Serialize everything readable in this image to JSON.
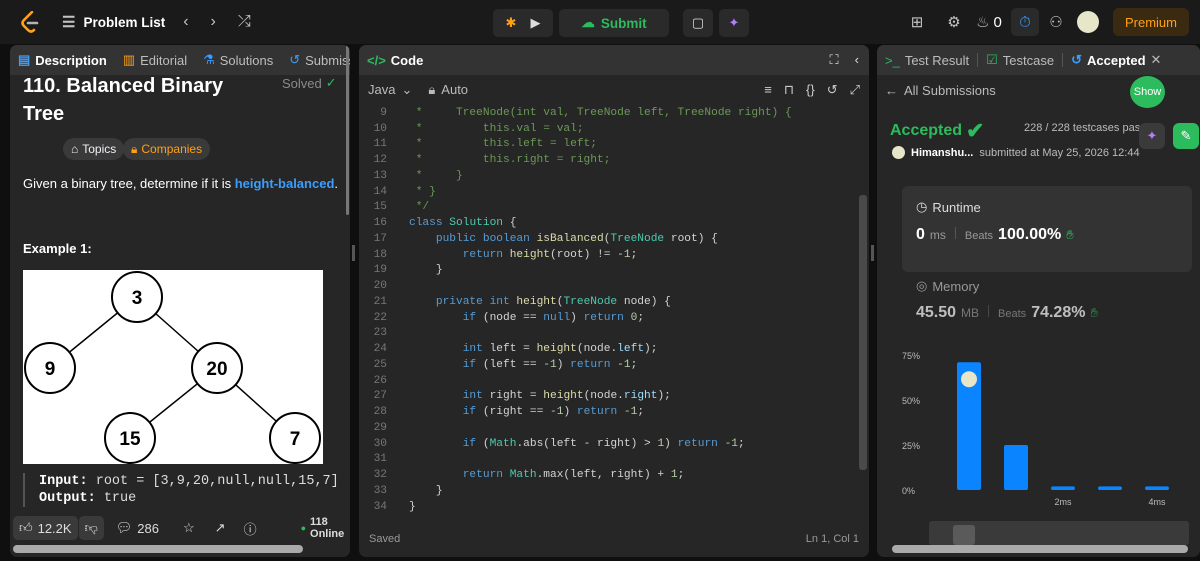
{
  "topbar": {
    "problem_list_label": "Problem List",
    "streak_count": "0",
    "premium_label": "Premium",
    "submit_label": "Submit"
  },
  "left_panel": {
    "tabs": [
      {
        "label": "Description",
        "icon": "document-icon"
      },
      {
        "label": "Editorial",
        "icon": "book-icon"
      },
      {
        "label": "Solutions",
        "icon": "flask-icon"
      },
      {
        "label": "Submiss",
        "icon": "history-icon"
      }
    ],
    "title": "110. Balanced Binary Tree",
    "solved_label": "Solved",
    "topics_label": "Topics",
    "companies_label": "Companies",
    "description_prefix": "Given a binary tree, determine if it is ",
    "description_highlight": "height-balanced",
    "description_suffix": ".",
    "example_title": "Example 1:",
    "tree_nodes": [
      "3",
      "9",
      "20",
      "15",
      "7"
    ],
    "input_label": "Input:",
    "input_value": "root = [3,9,20,null,null,15,7]",
    "output_label": "Output:",
    "output_value": "true",
    "likes": "12.2K",
    "comments": "286",
    "online": "118 Online"
  },
  "code_panel": {
    "title": "Code",
    "language": "Java",
    "mode": "Auto",
    "status": "Saved",
    "cursor": "Ln 1, Col 1"
  },
  "code_lines": [
    [
      {
        "t": " *     TreeNode(int val, TreeNode left, TreeNode right) {",
        "c": "cm"
      }
    ],
    [
      {
        "t": " *         this.val = val;",
        "c": "cm"
      }
    ],
    [
      {
        "t": " *         this.left = left;",
        "c": "cm"
      }
    ],
    [
      {
        "t": " *         this.right = right;",
        "c": "cm"
      }
    ],
    [
      {
        "t": " *     }",
        "c": "cm"
      }
    ],
    [
      {
        "t": " * }",
        "c": "cm"
      }
    ],
    [
      {
        "t": " */",
        "c": "cm"
      }
    ],
    [
      {
        "t": "class ",
        "c": "kw"
      },
      {
        "t": "Solution",
        "c": "ty"
      },
      {
        "t": " {",
        "c": "tx"
      }
    ],
    [
      {
        "t": "    public boolean ",
        "c": "kw"
      },
      {
        "t": "isBalanced",
        "c": "fn"
      },
      {
        "t": "(",
        "c": "tx"
      },
      {
        "t": "TreeNode",
        "c": "ty"
      },
      {
        "t": " root) {",
        "c": "tx"
      }
    ],
    [
      {
        "t": "        return ",
        "c": "kw"
      },
      {
        "t": "height",
        "c": "fn"
      },
      {
        "t": "(root) != ",
        "c": "tx"
      },
      {
        "t": "-1",
        "c": "nm"
      },
      {
        "t": ";",
        "c": "tx"
      }
    ],
    [
      {
        "t": "    }",
        "c": "tx"
      }
    ],
    [
      {
        "t": "",
        "c": "tx"
      }
    ],
    [
      {
        "t": "    private int ",
        "c": "kw"
      },
      {
        "t": "height",
        "c": "fn"
      },
      {
        "t": "(",
        "c": "tx"
      },
      {
        "t": "TreeNode",
        "c": "ty"
      },
      {
        "t": " node) {",
        "c": "tx"
      }
    ],
    [
      {
        "t": "        if ",
        "c": "kw"
      },
      {
        "t": "(node == ",
        "c": "tx"
      },
      {
        "t": "null",
        "c": "kw"
      },
      {
        "t": ") ",
        "c": "tx"
      },
      {
        "t": "return ",
        "c": "kw"
      },
      {
        "t": "0",
        "c": "nm"
      },
      {
        "t": ";",
        "c": "tx"
      }
    ],
    [
      {
        "t": "",
        "c": "tx"
      }
    ],
    [
      {
        "t": "        int ",
        "c": "kw"
      },
      {
        "t": "left = ",
        "c": "tx"
      },
      {
        "t": "height",
        "c": "fn"
      },
      {
        "t": "(node.",
        "c": "tx"
      },
      {
        "t": "left",
        "c": "pa"
      },
      {
        "t": ");",
        "c": "tx"
      }
    ],
    [
      {
        "t": "        if ",
        "c": "kw"
      },
      {
        "t": "(left == ",
        "c": "tx"
      },
      {
        "t": "-1",
        "c": "nm"
      },
      {
        "t": ") ",
        "c": "tx"
      },
      {
        "t": "return ",
        "c": "kw"
      },
      {
        "t": "-1",
        "c": "nm"
      },
      {
        "t": ";",
        "c": "tx"
      }
    ],
    [
      {
        "t": "",
        "c": "tx"
      }
    ],
    [
      {
        "t": "        int ",
        "c": "kw"
      },
      {
        "t": "right = ",
        "c": "tx"
      },
      {
        "t": "height",
        "c": "fn"
      },
      {
        "t": "(node.",
        "c": "tx"
      },
      {
        "t": "right",
        "c": "pa"
      },
      {
        "t": ");",
        "c": "tx"
      }
    ],
    [
      {
        "t": "        if ",
        "c": "kw"
      },
      {
        "t": "(right == ",
        "c": "tx"
      },
      {
        "t": "-1",
        "c": "nm"
      },
      {
        "t": ") ",
        "c": "tx"
      },
      {
        "t": "return ",
        "c": "kw"
      },
      {
        "t": "-1",
        "c": "nm"
      },
      {
        "t": ";",
        "c": "tx"
      }
    ],
    [
      {
        "t": "",
        "c": "tx"
      }
    ],
    [
      {
        "t": "        if ",
        "c": "kw"
      },
      {
        "t": "(",
        "c": "tx"
      },
      {
        "t": "Math",
        "c": "ty"
      },
      {
        "t": ".abs(left - right) > ",
        "c": "tx"
      },
      {
        "t": "1",
        "c": "nm"
      },
      {
        "t": ") ",
        "c": "tx"
      },
      {
        "t": "return ",
        "c": "kw"
      },
      {
        "t": "-1",
        "c": "nm"
      },
      {
        "t": ";",
        "c": "tx"
      }
    ],
    [
      {
        "t": "",
        "c": "tx"
      }
    ],
    [
      {
        "t": "        return ",
        "c": "kw"
      },
      {
        "t": "Math",
        "c": "ty"
      },
      {
        "t": ".max(left, right) + ",
        "c": "tx"
      },
      {
        "t": "1",
        "c": "nm"
      },
      {
        "t": ";",
        "c": "tx"
      }
    ],
    [
      {
        "t": "    }",
        "c": "tx"
      }
    ],
    [
      {
        "t": "}",
        "c": "tx"
      }
    ]
  ],
  "line_numbers": [
    "9",
    "10",
    "11",
    "12",
    "13",
    "14",
    "15",
    "16",
    "17",
    "18",
    "19",
    "20",
    "21",
    "22",
    "23",
    "24",
    "25",
    "26",
    "27",
    "28",
    "29",
    "30",
    "31",
    "32",
    "33",
    "34"
  ],
  "right_panel": {
    "tabs": [
      {
        "label": "Test Result"
      },
      {
        "label": "Testcase"
      },
      {
        "label": "Accepted"
      }
    ],
    "all_submissions_label": "All Submissions",
    "show_label": "Show",
    "status": "Accepted",
    "passed": "228 / 228 testcases passed",
    "user": "Himanshu...",
    "submitted_at": "submitted at May 25, 2026 12:44",
    "runtime_label": "Runtime",
    "runtime_value": "0",
    "runtime_unit": "ms",
    "beats_label": "Beats",
    "runtime_beats": "100.00%",
    "memory_label": "Memory",
    "memory_value": "45.50",
    "memory_unit": "MB",
    "memory_beats": "74.28%"
  },
  "chart_data": {
    "type": "bar",
    "categories": [
      "",
      "",
      "2ms",
      "",
      "4ms"
    ],
    "values": [
      71,
      25,
      2,
      2,
      2
    ],
    "yticks": [
      "75%",
      "50%",
      "25%",
      "0%"
    ],
    "ylim": [
      0,
      75
    ],
    "bar_color": "#0a84ff",
    "highlight_index": 0
  }
}
